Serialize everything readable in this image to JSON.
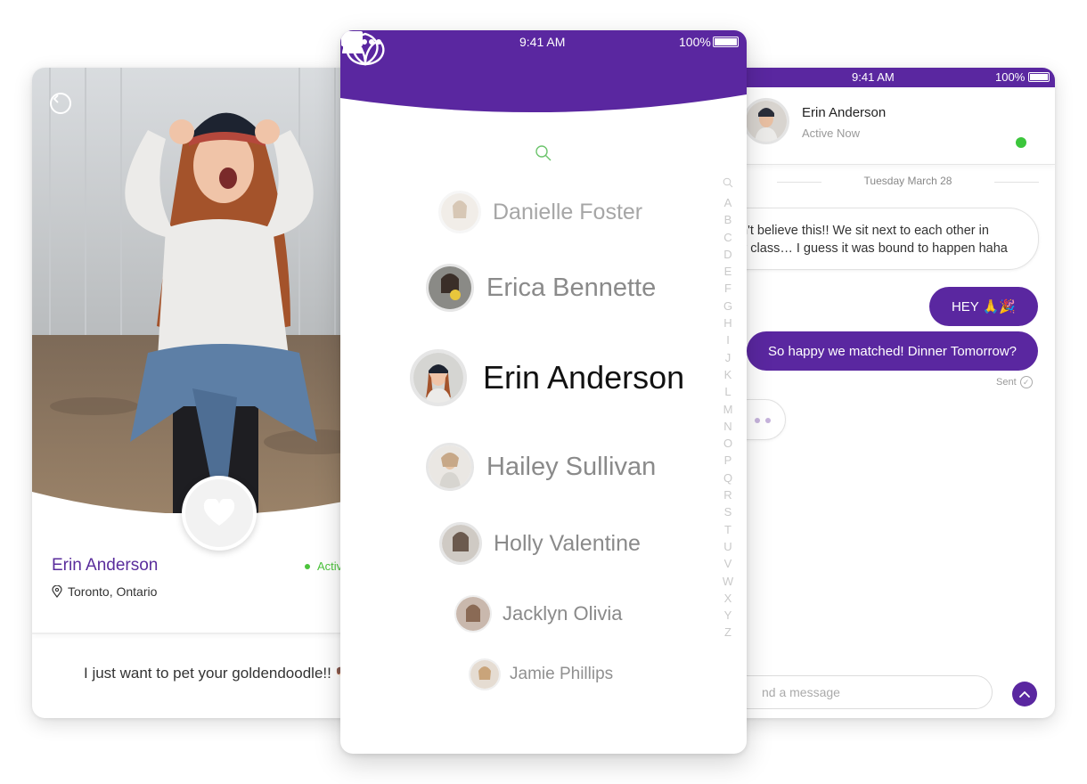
{
  "profile": {
    "name": "Erin Anderson",
    "status": "Active",
    "location": "Toronto, Ontario",
    "message": "I just want to pet your goldendoodle!! 🐶"
  },
  "phone": {
    "status_time": "9:41 AM",
    "battery_pct": "100%",
    "contacts": [
      {
        "name": "Danielle Foster"
      },
      {
        "name": "Erica Bennette"
      },
      {
        "name": "Erin Anderson"
      },
      {
        "name": "Hailey Sullivan"
      },
      {
        "name": "Holly Valentine"
      },
      {
        "name": "Jacklyn Olivia"
      },
      {
        "name": "Jamie Phillips"
      }
    ],
    "alphabet": [
      "A",
      "B",
      "C",
      "D",
      "E",
      "F",
      "G",
      "H",
      "I",
      "J",
      "K",
      "L",
      "M",
      "N",
      "O",
      "P",
      "Q",
      "R",
      "S",
      "T",
      "U",
      "V",
      "W",
      "X",
      "Y",
      "Z"
    ]
  },
  "chat": {
    "status_time": "9:41 AM",
    "battery_pct": "100%",
    "contact_name": "Erin Anderson",
    "contact_status": "Active Now",
    "date": "Tuesday March 28",
    "incoming_message": "n't believe this!! We sit next to each other in\ny class… I guess it was bound to happen haha",
    "outgoing_1": "HEY 🙏🎉",
    "outgoing_2": "So happy we matched! Dinner Tomorrow?",
    "sent_label": "Sent",
    "input_placeholder": "nd a message"
  },
  "colors": {
    "brand_purple": "#5a27a0",
    "online_green": "#3cc63c"
  }
}
